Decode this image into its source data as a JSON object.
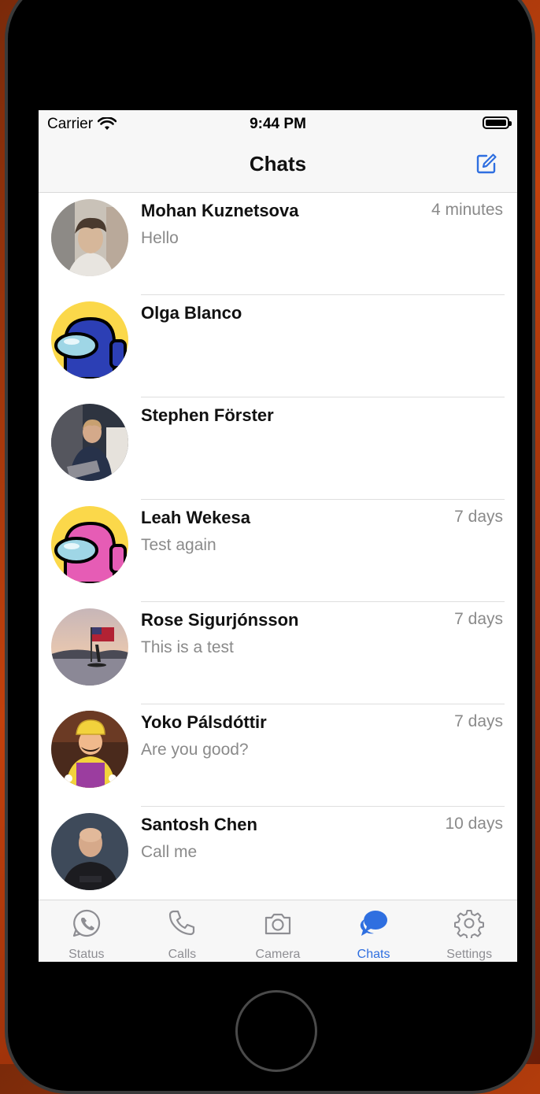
{
  "status_bar": {
    "carrier": "Carrier",
    "time": "9:44 PM"
  },
  "nav": {
    "title": "Chats",
    "compose_icon": "compose-icon"
  },
  "chats": [
    {
      "name": "Mohan Kuznetsova",
      "preview": "Hello",
      "time": "4 minutes"
    },
    {
      "name": "Olga Blanco",
      "preview": "",
      "time": ""
    },
    {
      "name": "Stephen Förster",
      "preview": "",
      "time": ""
    },
    {
      "name": "Leah Wekesa",
      "preview": "Test again",
      "time": "7 days"
    },
    {
      "name": "Rose Sigurjónsson",
      "preview": "This is a test",
      "time": "7 days"
    },
    {
      "name": "Yoko Pálsdóttir",
      "preview": "Are you good?",
      "time": "7 days"
    },
    {
      "name": "Santosh Chen",
      "preview": "Call me",
      "time": "10 days"
    }
  ],
  "tabs": [
    {
      "label": "Status",
      "icon": "status-icon"
    },
    {
      "label": "Calls",
      "icon": "phone-icon"
    },
    {
      "label": "Camera",
      "icon": "camera-icon"
    },
    {
      "label": "Chats",
      "icon": "chat-bubbles-icon",
      "active": true
    },
    {
      "label": "Settings",
      "icon": "gear-icon"
    }
  ],
  "colors": {
    "accent": "#2f6fe0",
    "muted": "#8e8e93",
    "bar": "#f7f7f7"
  }
}
